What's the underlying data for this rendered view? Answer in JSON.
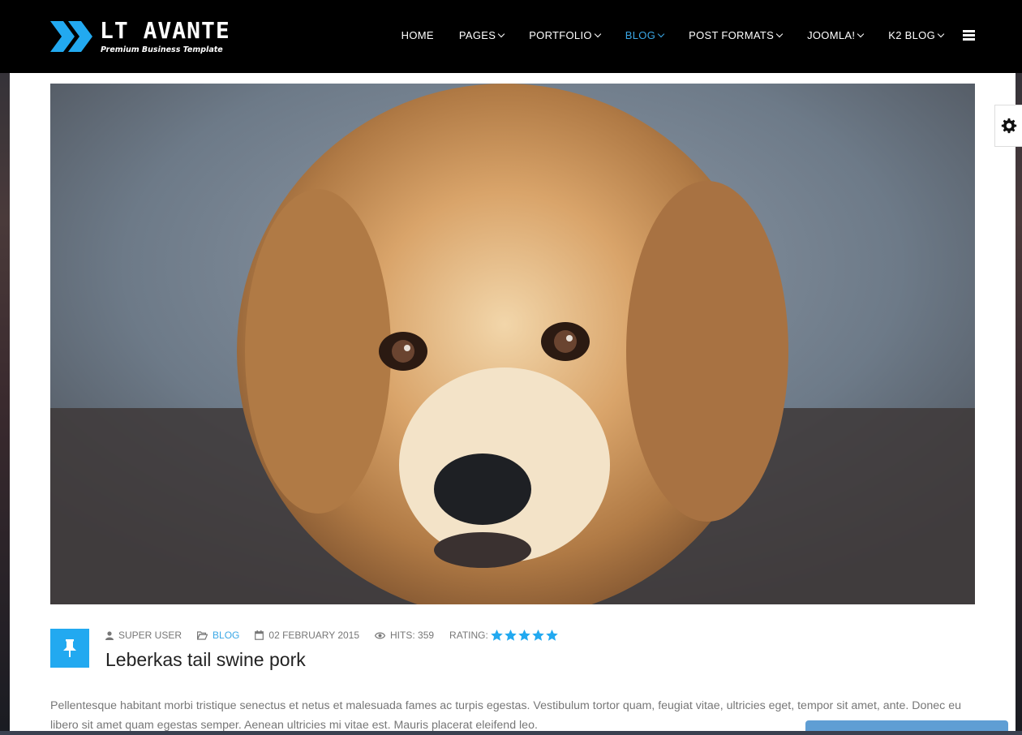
{
  "brand": {
    "title": "LT AVANTE",
    "subtitle": "Premium Business Template"
  },
  "nav": {
    "items": [
      {
        "label": "HOME",
        "has_caret": false,
        "active": false
      },
      {
        "label": "PAGES",
        "has_caret": true,
        "active": false
      },
      {
        "label": "PORTFOLIO",
        "has_caret": true,
        "active": false
      },
      {
        "label": "BLOG",
        "has_caret": true,
        "active": true
      },
      {
        "label": "POST FORMATS",
        "has_caret": true,
        "active": false
      },
      {
        "label": "JOOMLA!",
        "has_caret": true,
        "active": false
      },
      {
        "label": "K2 BLOG",
        "has_caret": true,
        "active": false
      }
    ],
    "menu_icon": "hamburger-icon"
  },
  "post": {
    "format_icon": "pushpin-icon",
    "author": "SUPER USER",
    "category": "BLOG",
    "date": "02 FEBRUARY 2015",
    "hits": "HITS: 359",
    "rating_label": "RATING:",
    "rating_stars": 5,
    "title": "Leberkas tail swine pork",
    "body": "Pellentesque habitant morbi tristique senectus et netus et malesuada fames ac turpis egestas. Vestibulum tortor quam, feugiat vitae, ultricies eget, tempor sit amet, ante. Donec eu libero sit amet quam egestas semper. Aenean ultricies mi vitae est. Mauris placerat eleifend leo."
  },
  "colors": {
    "accent": "#22a9f0",
    "nav_active": "#3aa7e6",
    "header_bg": "#000000"
  },
  "widgets": {
    "settings_icon": "gear-icon"
  }
}
